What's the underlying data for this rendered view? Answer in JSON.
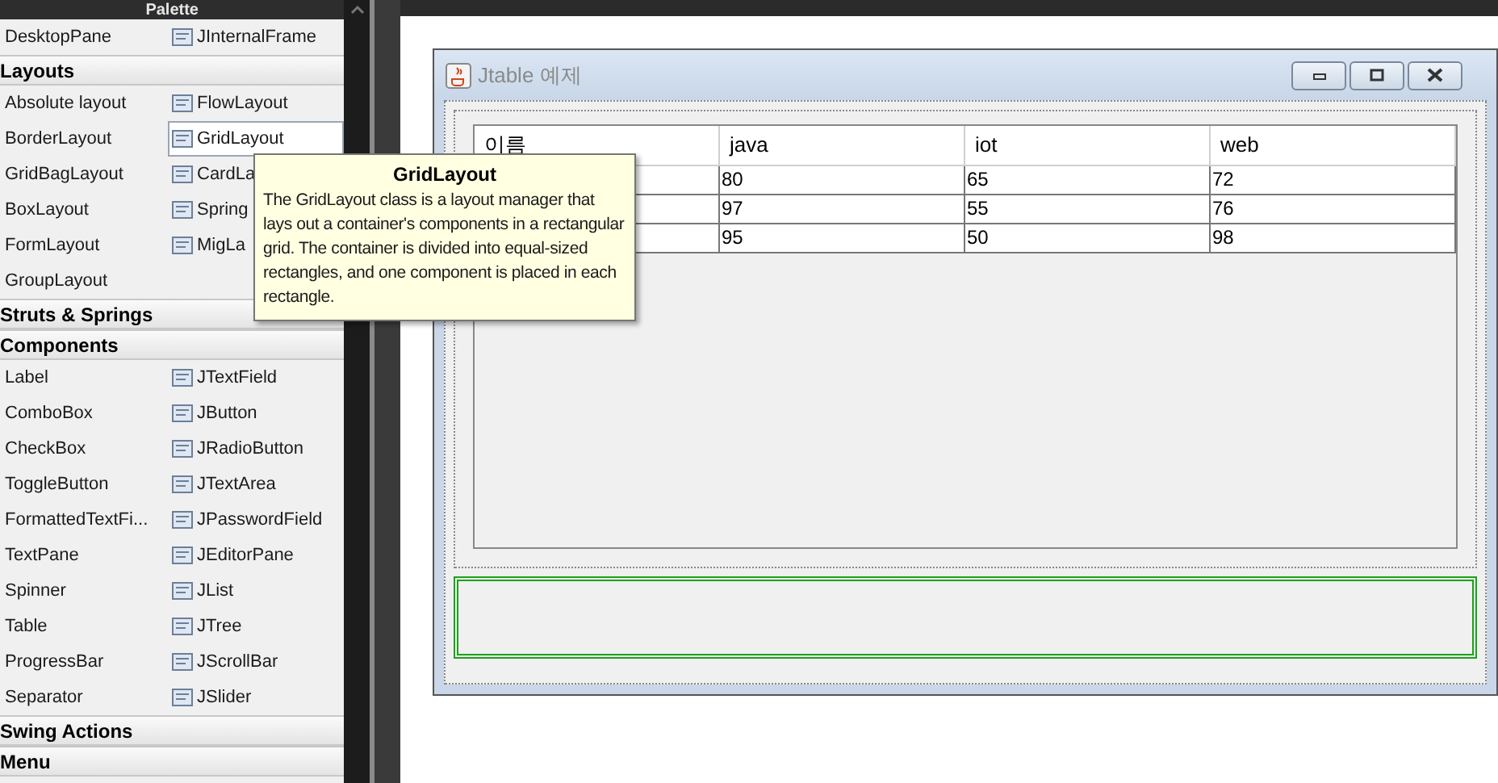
{
  "palette": {
    "title": "Palette",
    "groups": [
      {
        "items": [
          {
            "label": "DesktopPane",
            "selected": false
          },
          {
            "label": "JInternalFrame",
            "selected": false
          }
        ]
      },
      {
        "title": "Layouts",
        "items": [
          {
            "label": "Absolute layout",
            "selected": false
          },
          {
            "label": "FlowLayout",
            "selected": false
          },
          {
            "label": "BorderLayout",
            "selected": false
          },
          {
            "label": "GridLayout",
            "selected": true
          },
          {
            "label": "GridBagLayout",
            "selected": false
          },
          {
            "label": "CardLa",
            "selected": false
          },
          {
            "label": "BoxLayout",
            "selected": false
          },
          {
            "label": "Spring",
            "selected": false
          },
          {
            "label": "FormLayout",
            "selected": false
          },
          {
            "label": "MigLa",
            "selected": false
          },
          {
            "label": "GroupLayout",
            "selected": false
          }
        ]
      },
      {
        "title": "Struts & Springs"
      },
      {
        "title": "Components",
        "items": [
          {
            "label": "Label",
            "selected": false
          },
          {
            "label": "JTextField",
            "selected": false
          },
          {
            "label": "ComboBox",
            "selected": false
          },
          {
            "label": "JButton",
            "selected": false
          },
          {
            "label": "CheckBox",
            "selected": false
          },
          {
            "label": "JRadioButton",
            "selected": false
          },
          {
            "label": "ToggleButton",
            "selected": false
          },
          {
            "label": "JTextArea",
            "selected": false
          },
          {
            "label": "FormattedTextFi...",
            "selected": false
          },
          {
            "label": "JPasswordField",
            "selected": false
          },
          {
            "label": "TextPane",
            "selected": false
          },
          {
            "label": "JEditorPane",
            "selected": false
          },
          {
            "label": "Spinner",
            "selected": false
          },
          {
            "label": "JList",
            "selected": false
          },
          {
            "label": "Table",
            "selected": false
          },
          {
            "label": "JTree",
            "selected": false
          },
          {
            "label": "ProgressBar",
            "selected": false
          },
          {
            "label": "JScrollBar",
            "selected": false
          },
          {
            "label": "Separator",
            "selected": false
          },
          {
            "label": "JSlider",
            "selected": false
          }
        ]
      },
      {
        "title": "Swing Actions"
      },
      {
        "title": "Menu"
      }
    ]
  },
  "tooltip": {
    "title": "GridLayout",
    "text": "The GridLayout class is a layout manager that lays out a container's components in a rectangular grid. The container is divided into equal-sized rectangles, and one component is placed in each rectangle."
  },
  "window": {
    "title": "Jtable 예제"
  },
  "table": {
    "columns": [
      "이름",
      "java",
      "iot",
      "web"
    ],
    "rows": [
      {
        "cells": [
          "",
          "80",
          "65",
          "72"
        ]
      },
      {
        "cells": [
          "",
          "97",
          "55",
          "76"
        ]
      },
      {
        "cells": [
          "",
          "95",
          "50",
          "98"
        ]
      }
    ]
  }
}
